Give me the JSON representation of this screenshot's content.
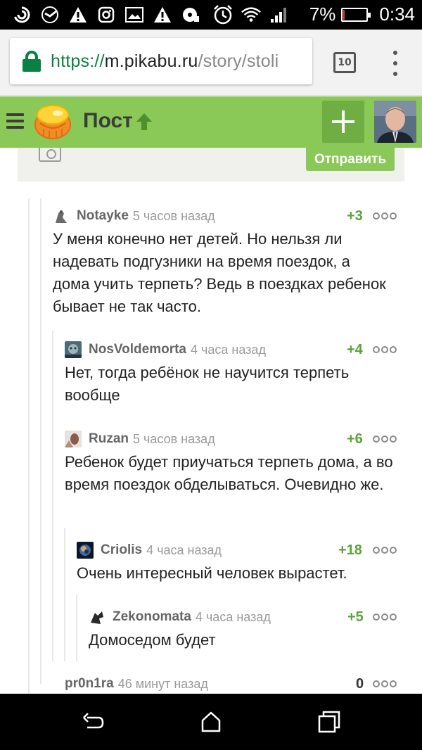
{
  "status_bar": {
    "battery": "7%",
    "battery_level": 0.07,
    "time": "0:34",
    "icons": [
      "sync-icon",
      "sberbank-icon",
      "warning-icon",
      "instagram-icon",
      "image-icon",
      "warning-icon",
      "headset-icon",
      "alarm-icon",
      "wifi-icon",
      "signal-icon",
      "battery-icon"
    ]
  },
  "browser": {
    "url_scheme": "https://",
    "url_host": "m.pikabu.ru",
    "url_path": "/story/stoli",
    "tab_count": "10"
  },
  "header": {
    "title": "Пост",
    "accent_color": "#8ac858"
  },
  "form": {
    "send_label": "Отправить"
  },
  "comments": [
    {
      "user": "Notayke",
      "time": "5 часов назад",
      "rating": "+3",
      "text": "У меня конечно нет детей. Но нельзя ли надевать подгузники на время поездок, а дома учить терпеть? Ведь в поездках ребенок бывает не так часто."
    },
    {
      "user": "NosVoldemorta",
      "time": "4 часа назад",
      "rating": "+4",
      "text": "Нет, тогда ребёнок не научится терпеть вообще"
    },
    {
      "user": "Ruzan",
      "time": "5 часов назад",
      "rating": "+6",
      "text": "Ребенок будет приучаться терпеть дома, а во время поездок обделываться. Очевидно же."
    },
    {
      "user": "Criolis",
      "time": "4 часа назад",
      "rating": "+18",
      "text": "Очень интересный человек вырастет."
    },
    {
      "user": "Zekonomata",
      "time": "4 часа назад",
      "rating": "+5",
      "text": "Домоседом будет"
    },
    {
      "user": "pr0n1ra",
      "time": "46 минут назад",
      "rating": "0",
      "text": ""
    }
  ]
}
